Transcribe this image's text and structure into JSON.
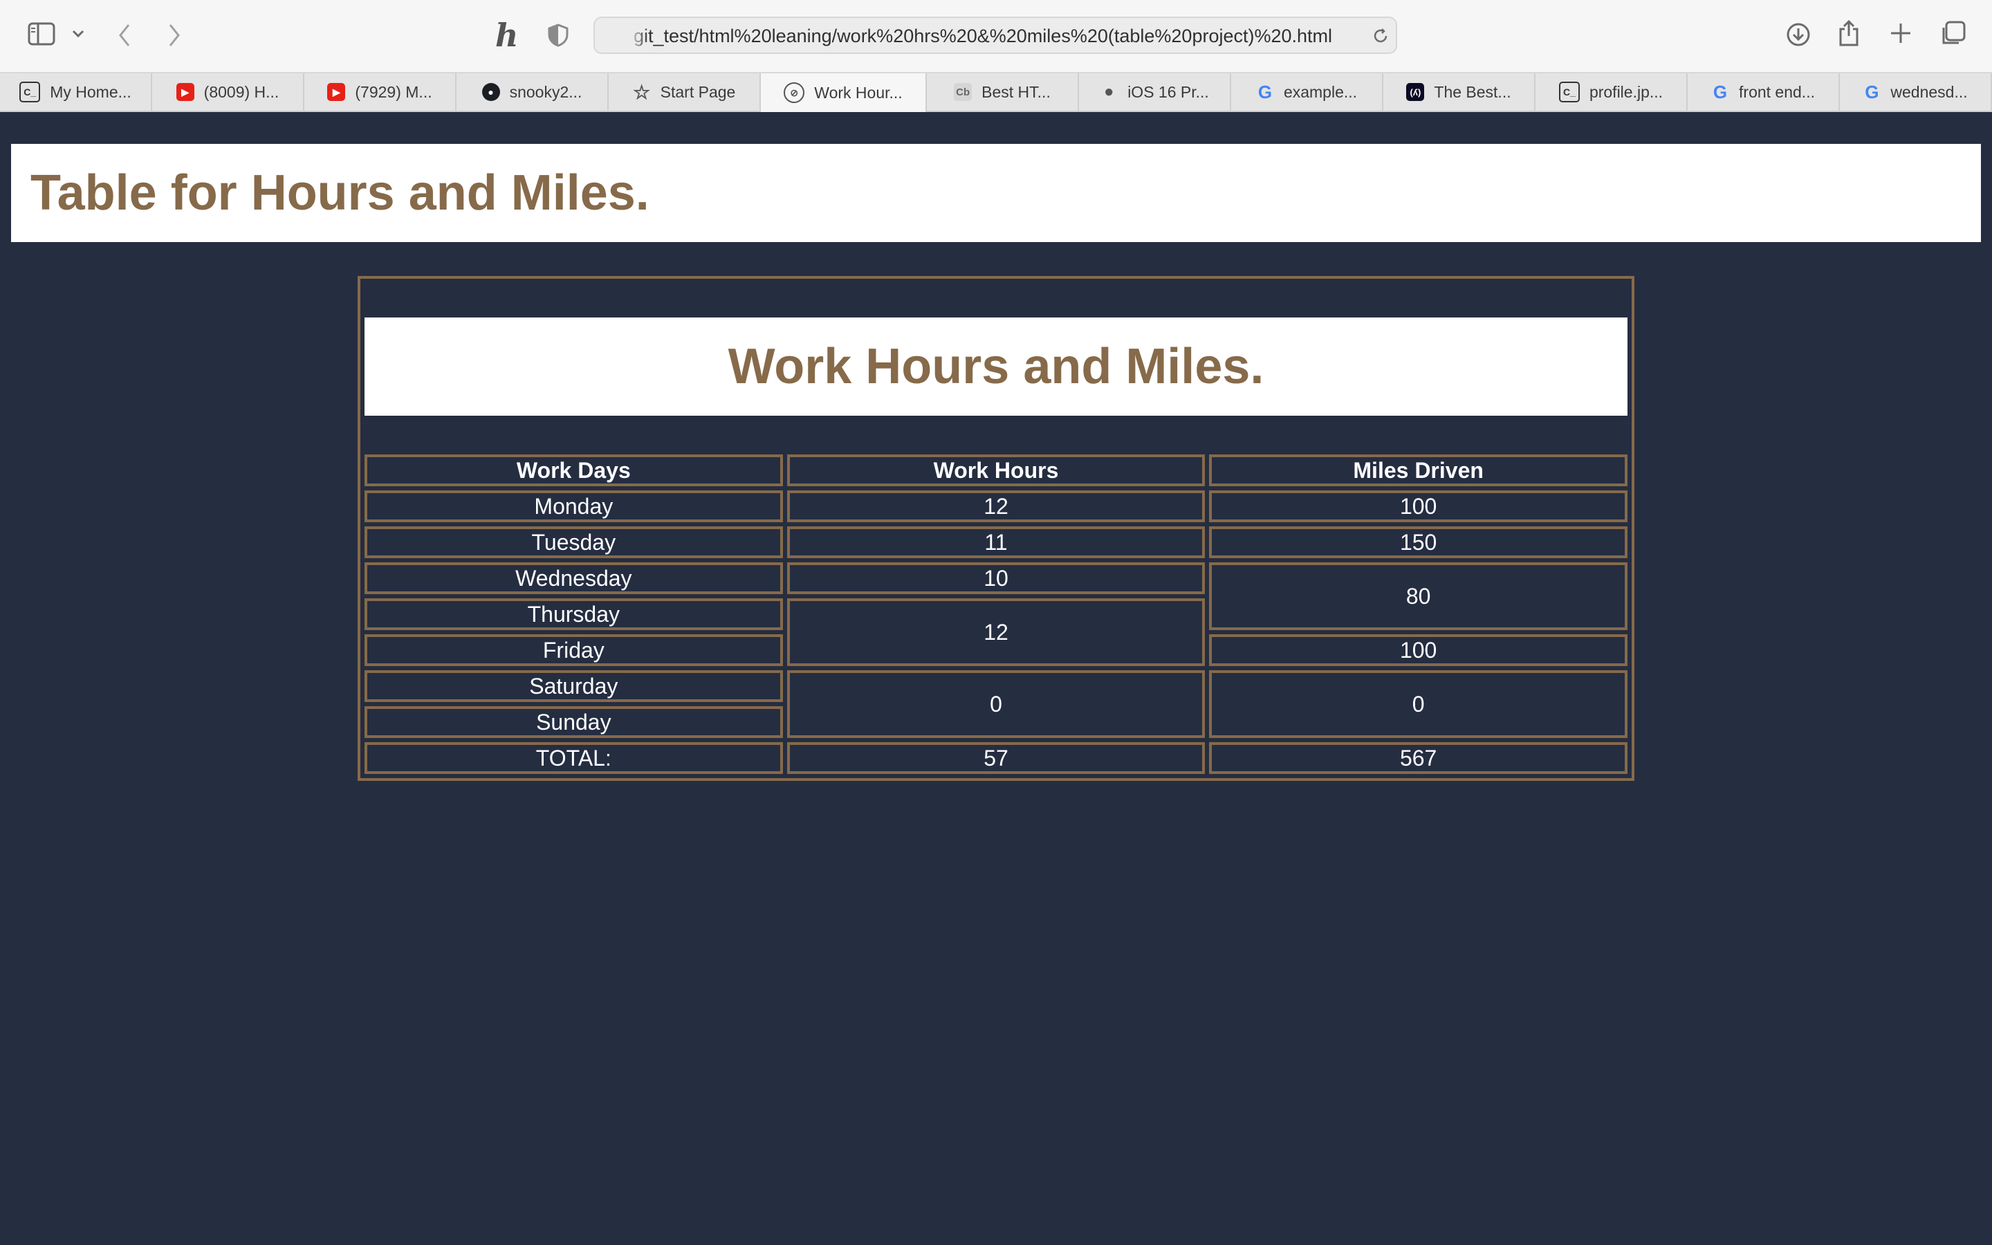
{
  "browser": {
    "url": "git_test/html%20leaning/work%20hrs%20&%20miles%20(table%20project)%20.html",
    "tabs": [
      {
        "label": "My Home...",
        "icon": "codepen-icon"
      },
      {
        "label": "(8009) H...",
        "icon": "youtube-icon"
      },
      {
        "label": "(7929) M...",
        "icon": "youtube-icon"
      },
      {
        "label": "snooky2...",
        "icon": "github-icon"
      },
      {
        "label": "Start Page",
        "icon": "star-icon"
      },
      {
        "label": "Work Hour...",
        "icon": "compass-icon"
      },
      {
        "label": "Best HT...",
        "icon": "codebeautify-icon"
      },
      {
        "label": "iOS 16 Pr...",
        "icon": "apple-icon"
      },
      {
        "label": "example...",
        "icon": "google-icon"
      },
      {
        "label": "The Best...",
        "icon": "freecodecamp-icon"
      },
      {
        "label": "profile.jp...",
        "icon": "codepen-icon"
      },
      {
        "label": "front end...",
        "icon": "google-icon"
      },
      {
        "label": "wednesd...",
        "icon": "google-icon"
      }
    ],
    "active_tab": 5
  },
  "page": {
    "title": "Table for Hours and Miles."
  },
  "table": {
    "caption": "Work Hours and Miles.",
    "headers": [
      "Work Days",
      "Work Hours",
      "Miles Driven"
    ],
    "days": [
      "Monday",
      "Tuesday",
      "Wednesday",
      "Thursday",
      "Friday",
      "Saturday",
      "Sunday"
    ],
    "hours": [
      "12",
      "11",
      "10",
      "12",
      "0"
    ],
    "miles": [
      "100",
      "150",
      "80",
      "100",
      "0"
    ],
    "total_label": "TOTAL:",
    "total_hours": "57",
    "total_miles": "567"
  },
  "colors": {
    "background": "#252d41",
    "accent": "#866a4a",
    "header_bg": "#ffffff",
    "text": "#ffffff"
  }
}
